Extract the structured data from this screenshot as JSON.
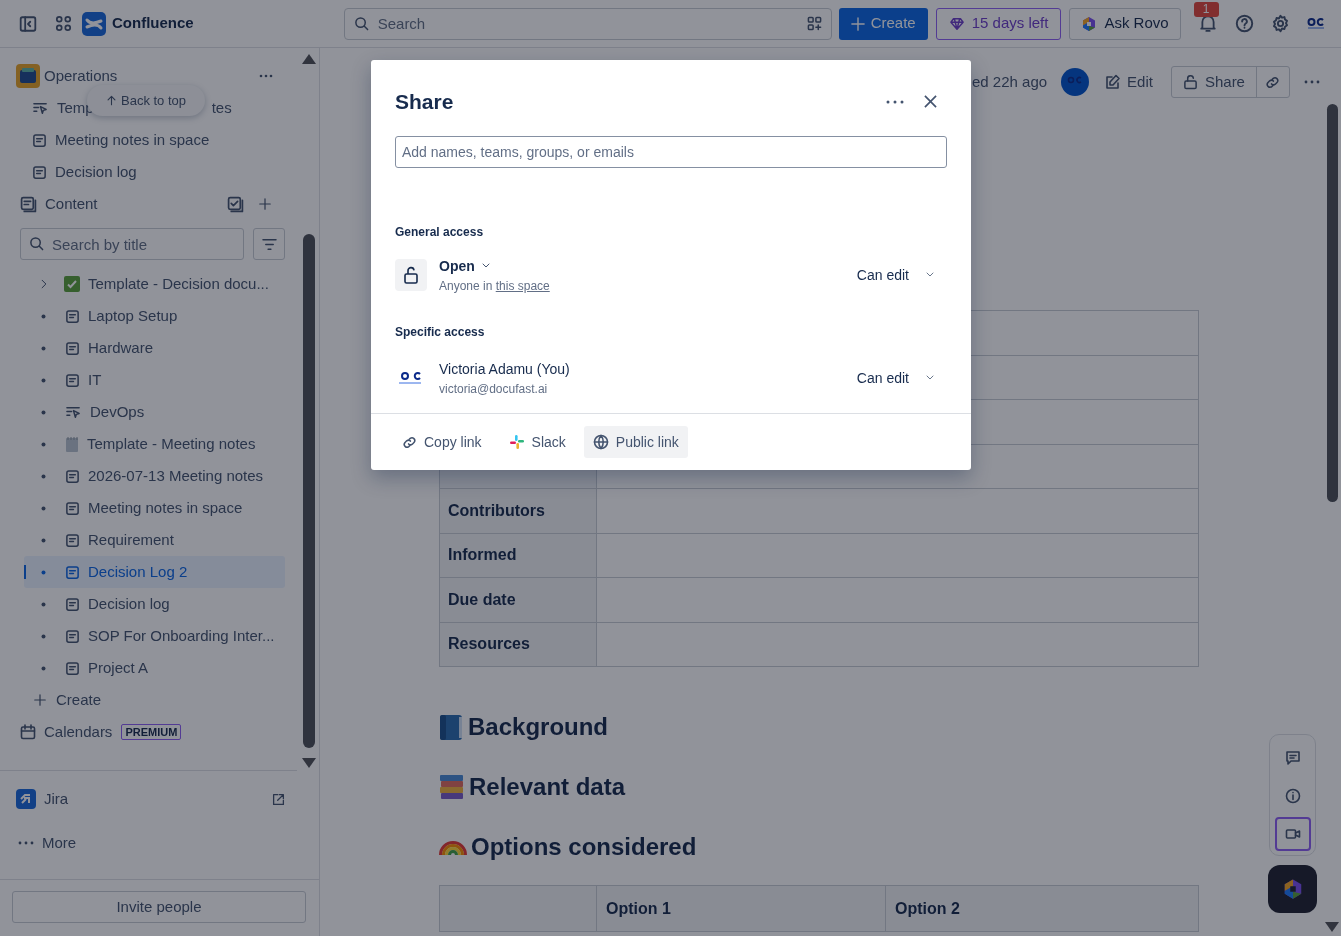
{
  "top_bar": {
    "product": "Confluence",
    "search_placeholder": "Search",
    "create_label": "Create",
    "trial_label": "15 days left",
    "rovo_label": "Ask Rovo",
    "notification_count": "1"
  },
  "sidebar": {
    "space_name": "Operations",
    "shortcuts": [
      {
        "kind": "live",
        "label_start": "Temp",
        "label_end": "tes"
      },
      {
        "kind": "page",
        "label": "Meeting notes in space"
      },
      {
        "kind": "page",
        "label": "Decision log"
      }
    ],
    "back_to_top": "Back to top",
    "content_label": "Content",
    "tree_search_placeholder": "Search by title",
    "tree": [
      {
        "kind": "check",
        "label": "Template - Decision docu...",
        "has_children": true,
        "selected": false
      },
      {
        "kind": "page",
        "label": "Laptop Setup",
        "has_children": false,
        "selected": false
      },
      {
        "kind": "page",
        "label": "Hardware",
        "has_children": false,
        "selected": false
      },
      {
        "kind": "page",
        "label": "IT",
        "has_children": false,
        "selected": false
      },
      {
        "kind": "live",
        "label": "DevOps",
        "has_children": false,
        "selected": false
      },
      {
        "kind": "notepad",
        "label": "Template - Meeting notes",
        "has_children": false,
        "selected": false
      },
      {
        "kind": "page",
        "label": "2026-07-13 Meeting notes",
        "has_children": false,
        "selected": false
      },
      {
        "kind": "page",
        "label": "Meeting notes in space",
        "has_children": false,
        "selected": false
      },
      {
        "kind": "page",
        "label": "Requirement",
        "has_children": false,
        "selected": false
      },
      {
        "kind": "page",
        "label": "Decision Log 2",
        "has_children": false,
        "selected": true
      },
      {
        "kind": "page",
        "label": "Decision log",
        "has_children": false,
        "selected": false
      },
      {
        "kind": "page",
        "label": "SOP For Onboarding Inter...",
        "has_children": false,
        "selected": false
      },
      {
        "kind": "page",
        "label": "Project A",
        "has_children": false,
        "selected": false
      }
    ],
    "create_label": "Create",
    "calendars_label": "Calendars",
    "calendars_badge": "PREMIUM",
    "apps": [
      {
        "kind": "jira",
        "label": "Jira"
      },
      {
        "kind": "more",
        "label": "More"
      }
    ],
    "invite_label": "Invite people"
  },
  "page": {
    "edited_fragment": "ed 22h ago",
    "edit_label": "Edit",
    "share_label": "Share",
    "table_rows": [
      {
        "label": "Contributors"
      },
      {
        "label": "Informed"
      },
      {
        "label": "Due date"
      },
      {
        "label": "Resources"
      }
    ],
    "headings": [
      {
        "kind": "book",
        "text": "Background"
      },
      {
        "kind": "books",
        "text": "Relevant data"
      },
      {
        "kind": "rainbow",
        "text": "Options considered"
      }
    ],
    "options_columns": [
      "Option 1",
      "Option 2"
    ]
  },
  "share_dialog": {
    "title": "Share",
    "invite_placeholder": "Add names, teams, groups, or emails",
    "general_heading": "General access",
    "general": {
      "mode": "Open",
      "note_prefix": "Anyone in",
      "note_link": "this space",
      "permission": "Can edit"
    },
    "specific_heading": "Specific access",
    "people": [
      {
        "name": "Victoria Adamu (You)",
        "email": "victoria@docufast.ai",
        "permission": "Can edit"
      }
    ],
    "actions": [
      {
        "kind": "link",
        "label": "Copy link",
        "selected": false
      },
      {
        "kind": "slack",
        "label": "Slack",
        "selected": false
      },
      {
        "kind": "globe",
        "label": "Public link",
        "selected": true
      }
    ]
  }
}
